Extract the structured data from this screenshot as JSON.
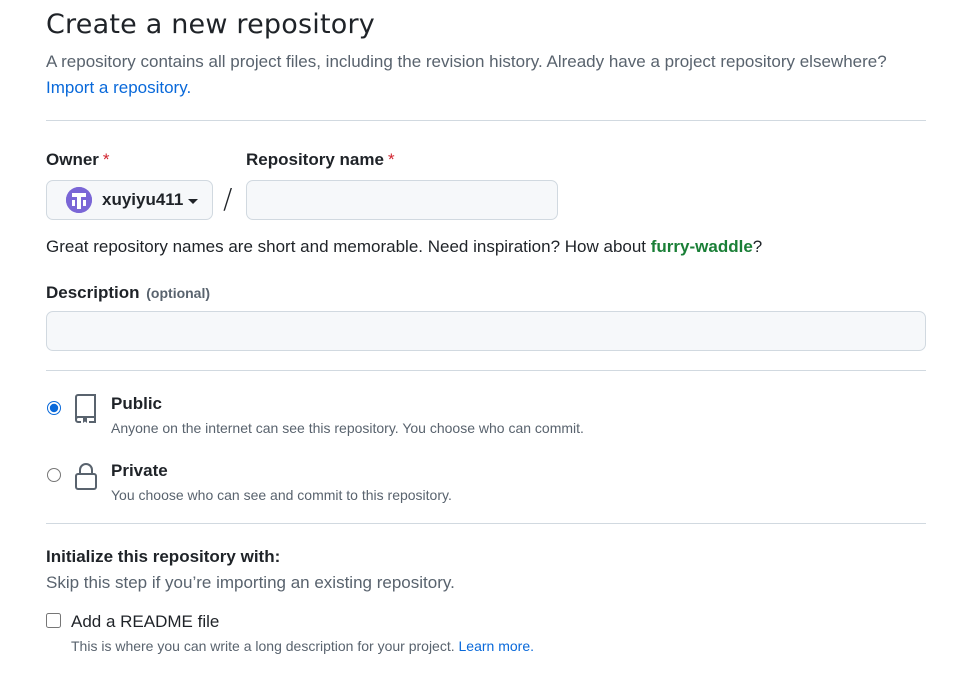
{
  "header": {
    "title": "Create a new repository",
    "subtitle": "A repository contains all project files, including the revision history. Already have a project repository elsewhere?",
    "import_link": "Import a repository."
  },
  "owner": {
    "label": "Owner",
    "required_mark": "*",
    "selected": "xuyiyu411",
    "avatar_color": "#7a66d6"
  },
  "repo_name": {
    "label": "Repository name",
    "required_mark": "*",
    "value": "",
    "separator": "/"
  },
  "name_hint": {
    "prefix": "Great repository names are short and memorable. Need inspiration? How about ",
    "suggestion": "furry-waddle",
    "suffix": "?"
  },
  "description": {
    "label": "Description",
    "optional": "(optional)",
    "value": ""
  },
  "visibility": {
    "selected": "public",
    "options": [
      {
        "id": "public",
        "title": "Public",
        "description": "Anyone on the internet can see this repository. You choose who can commit.",
        "icon": "repo-icon"
      },
      {
        "id": "private",
        "title": "Private",
        "description": "You choose who can see and commit to this repository.",
        "icon": "lock-icon"
      }
    ]
  },
  "initialize": {
    "title": "Initialize this repository with:",
    "subtitle": "Skip this step if you’re importing an existing repository.",
    "readme": {
      "label": "Add a README file",
      "checked": false,
      "description": "This is where you can write a long description for your project.",
      "learn_more": "Learn more."
    }
  },
  "colors": {
    "link": "#0969da",
    "suggestion": "#1a7f37",
    "required": "#d1242f",
    "border": "#d1d9e0",
    "input_bg": "#f6f8fa"
  }
}
